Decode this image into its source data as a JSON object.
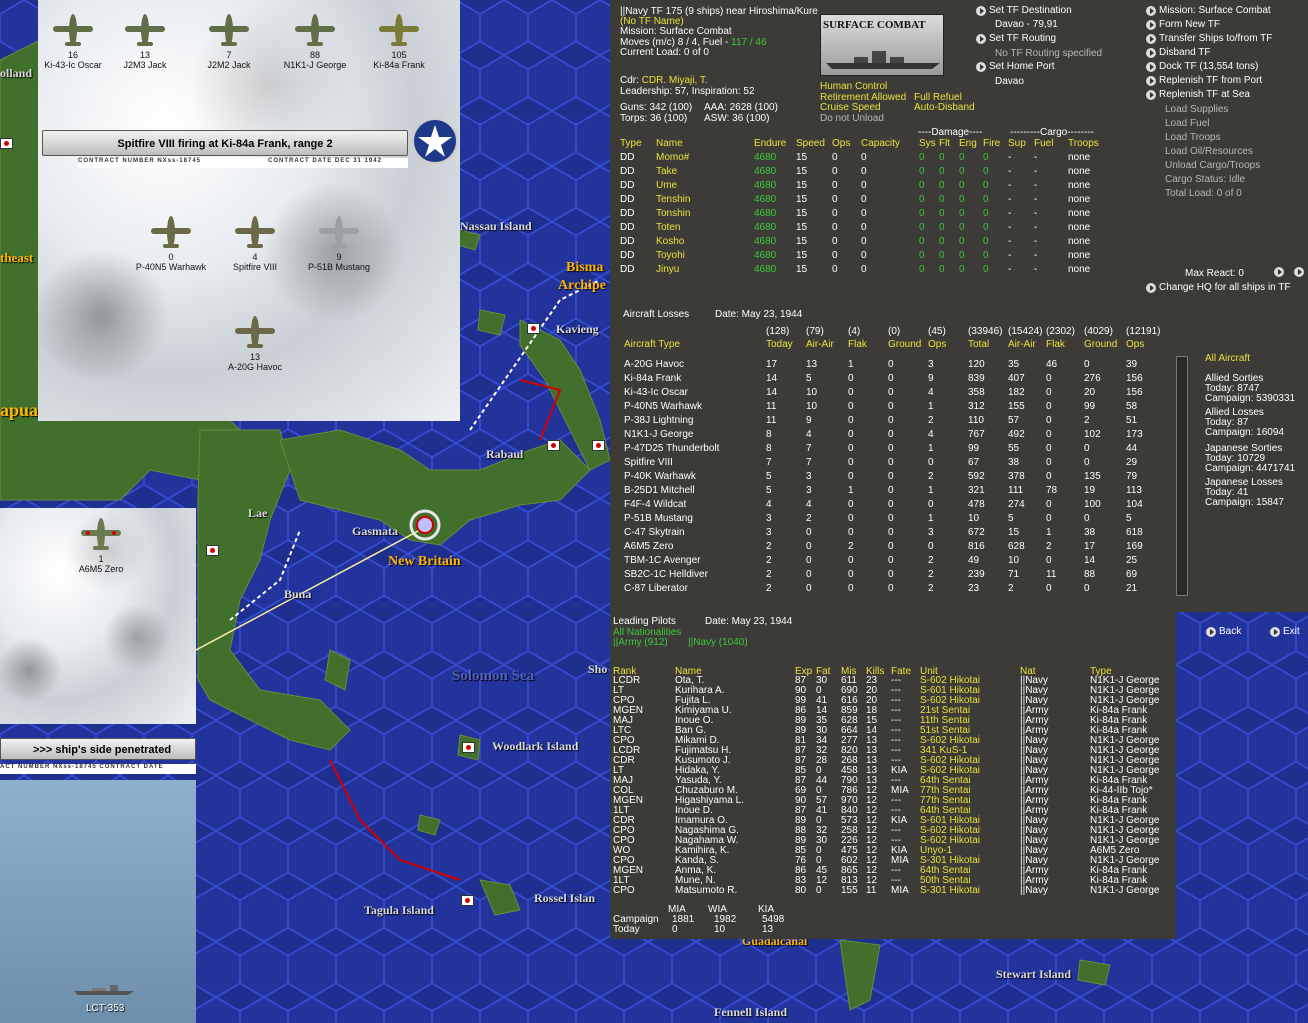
{
  "header": {
    "tf_line": "||Navy TF 175 (9 ships) near Hiroshima/Kure",
    "tf_name": "(No TF Name)",
    "mission": "Mission: Surface Combat",
    "moves": "Moves (m/c) 8 / 4, Fuel - ",
    "fuel": "117 / 46",
    "load": "Current Load: 0 of 0",
    "cdr_label": "Cdr:",
    "cdr": "CDR. Miyaji, T.",
    "leadership": "Leadership: 57, Inspiration: 52",
    "guns": "Guns: 342 (100)",
    "aaa": "AAA: 2628 (100)",
    "torps": "Torps: 36 (100)",
    "asw": "ASW: 36 (100)",
    "mission_box": "SURFACE COMBAT",
    "human": "Human Control",
    "retire": "Retirement Allowed",
    "refuel": "Full Refuel",
    "cruise": "Cruise Speed",
    "disband": "Auto-Disband",
    "unload": "Do not Unload"
  },
  "tf_controls": {
    "dest_btn": "Set TF Destination",
    "dest_val": "Davao - 79,91",
    "routing_btn": "Set TF Routing",
    "routing_val": "No TF Routing specified",
    "home_btn": "Set Home Port",
    "home_val": "Davao"
  },
  "right_menu": {
    "active": [
      "Mission: Surface Combat",
      "Form New TF",
      "Transfer Ships to/from TF",
      "Disband TF",
      "Dock TF (13,554 tons)",
      "Replenish TF from Port",
      "Replenish TF at Sea"
    ],
    "inactive": [
      "Load Supplies",
      "Load Fuel",
      "Load Troops",
      "Load Oil/Resources",
      "Unload Cargo/Troops",
      "Cargo Status: Idle",
      "Total Load: 0 of 0"
    ],
    "max_react": "Max React: 0",
    "change_hq": "Change HQ for all ships in TF"
  },
  "ships": {
    "group_damage": "----Damage----",
    "group_cargo": "---------Cargo--------",
    "headers": [
      "Type",
      "Name",
      "Endure",
      "Speed",
      "Ops",
      "Capacity",
      "Sys",
      "Flt",
      "Eng",
      "Fire",
      "Sup",
      "Fuel",
      "Troops"
    ],
    "rows": [
      [
        "DD",
        "Momo#",
        "4680",
        "15",
        "0",
        "0",
        "0",
        "0",
        "0",
        "0",
        "-",
        "-",
        "none"
      ],
      [
        "DD",
        "Take",
        "4680",
        "15",
        "0",
        "0",
        "0",
        "0",
        "0",
        "0",
        "-",
        "-",
        "none"
      ],
      [
        "DD",
        "Ume",
        "4680",
        "15",
        "0",
        "0",
        "0",
        "0",
        "0",
        "0",
        "-",
        "-",
        "none"
      ],
      [
        "DD",
        "Tenshin",
        "4680",
        "15",
        "0",
        "0",
        "0",
        "0",
        "0",
        "0",
        "-",
        "-",
        "none"
      ],
      [
        "DD",
        "Tonshin",
        "4680",
        "15",
        "0",
        "0",
        "0",
        "0",
        "0",
        "0",
        "-",
        "-",
        "none"
      ],
      [
        "DD",
        "Toten",
        "4680",
        "15",
        "0",
        "0",
        "0",
        "0",
        "0",
        "0",
        "-",
        "-",
        "none"
      ],
      [
        "DD",
        "Kosho",
        "4680",
        "15",
        "0",
        "0",
        "0",
        "0",
        "0",
        "0",
        "-",
        "-",
        "none"
      ],
      [
        "DD",
        "Toyohi",
        "4680",
        "15",
        "0",
        "0",
        "0",
        "0",
        "0",
        "0",
        "-",
        "-",
        "none"
      ],
      [
        "DD",
        "Jinyu",
        "4680",
        "15",
        "0",
        "0",
        "0",
        "0",
        "0",
        "0",
        "-",
        "-",
        "none"
      ]
    ]
  },
  "losses": {
    "title": "Aircraft Losses",
    "date": "Date: May 23, 1944",
    "totals": [
      "(128)",
      "(79)",
      "(4)",
      "(0)",
      "(45)",
      "(33946)",
      "(15424)",
      "(2302)",
      "(4029)",
      "(12191)"
    ],
    "headers": [
      "Aircraft Type",
      "Today",
      "Air-Air",
      "Flak",
      "Ground",
      "Ops",
      "Total",
      "Air-Air",
      "Flak",
      "Ground",
      "Ops"
    ],
    "rows": [
      [
        "A-20G Havoc",
        "17",
        "13",
        "1",
        "0",
        "3",
        "120",
        "35",
        "46",
        "0",
        "39"
      ],
      [
        "Ki-84a Frank",
        "14",
        "5",
        "0",
        "0",
        "9",
        "839",
        "407",
        "0",
        "276",
        "156"
      ],
      [
        "Ki-43-Ic Oscar",
        "14",
        "10",
        "0",
        "0",
        "4",
        "358",
        "182",
        "0",
        "20",
        "156"
      ],
      [
        "P-40N5 Warhawk",
        "11",
        "10",
        "0",
        "0",
        "1",
        "312",
        "155",
        "0",
        "99",
        "58"
      ],
      [
        "P-38J Lightning",
        "11",
        "9",
        "0",
        "0",
        "2",
        "110",
        "57",
        "0",
        "2",
        "51"
      ],
      [
        "N1K1-J George",
        "8",
        "4",
        "0",
        "0",
        "4",
        "767",
        "492",
        "0",
        "102",
        "173"
      ],
      [
        "P-47D25 Thunderbolt",
        "8",
        "7",
        "0",
        "0",
        "1",
        "99",
        "55",
        "0",
        "0",
        "44"
      ],
      [
        "Spitfire VIII",
        "7",
        "7",
        "0",
        "0",
        "0",
        "67",
        "38",
        "0",
        "0",
        "29"
      ],
      [
        "P-40K Warhawk",
        "5",
        "3",
        "0",
        "0",
        "2",
        "592",
        "378",
        "0",
        "135",
        "79"
      ],
      [
        "B-25D1 Mitchell",
        "5",
        "3",
        "1",
        "0",
        "1",
        "321",
        "111",
        "78",
        "19",
        "113"
      ],
      [
        "F4F-4 Wildcat",
        "4",
        "4",
        "0",
        "0",
        "0",
        "478",
        "274",
        "0",
        "100",
        "104"
      ],
      [
        "P-51B Mustang",
        "3",
        "2",
        "0",
        "0",
        "1",
        "10",
        "5",
        "0",
        "0",
        "5"
      ],
      [
        "C-47 Skytrain",
        "3",
        "0",
        "0",
        "0",
        "3",
        "672",
        "15",
        "1",
        "38",
        "618"
      ],
      [
        "A6M5 Zero",
        "2",
        "0",
        "2",
        "0",
        "0",
        "816",
        "628",
        "2",
        "17",
        "169"
      ],
      [
        "TBM-1C Avenger",
        "2",
        "0",
        "0",
        "0",
        "2",
        "49",
        "10",
        "0",
        "14",
        "25"
      ],
      [
        "SB2C-1C Helldiver",
        "2",
        "0",
        "0",
        "0",
        "2",
        "239",
        "71",
        "11",
        "88",
        "69"
      ],
      [
        "C-87 Liberator",
        "2",
        "0",
        "0",
        "0",
        "2",
        "23",
        "2",
        "0",
        "0",
        "21"
      ]
    ],
    "side": {
      "filter": "All Aircraft",
      "allied_sorties": "Allied Sorties",
      "as_today": "Today:  8747",
      "as_campaign": "Campaign: 5390331",
      "allied_losses": "Allied Losses",
      "al_today": "Today:  87",
      "al_campaign": "Campaign: 16094",
      "jp_sorties": "Japanese Sorties",
      "js_today": "Today:  10729",
      "js_campaign": "Campaign: 4471741",
      "jp_losses": "Japanese Losses",
      "jl_today": "Today:  41",
      "jl_campaign": "Campaign: 15847"
    }
  },
  "nav": {
    "back": "Back",
    "exit": "Exit"
  },
  "pilots": {
    "title": "Leading Pilots",
    "date": "Date: May 23, 1944",
    "filter": "All Nationalities",
    "army": "||Army (912)",
    "navy": "||Navy (1040)",
    "headers": [
      "Rank",
      "Name",
      "Exp",
      "Fat",
      "Mis",
      "Kills",
      "Fate",
      "Unit",
      "Nat",
      "Type"
    ],
    "rows": [
      [
        "LCDR",
        "Ota, T.",
        "87",
        "30",
        "611",
        "23",
        "---",
        "S-602 Hikotai",
        "||Navy",
        "N1K1-J George"
      ],
      [
        "LT",
        "Kurihara A.",
        "90",
        "0",
        "690",
        "20",
        "---",
        "S-601 Hikotai",
        "||Navy",
        "N1K1-J George"
      ],
      [
        "CPO",
        "Fujita L.",
        "99",
        "41",
        "616",
        "20",
        "---",
        "S-602 Hikotai",
        "||Navy",
        "N1K1-J George"
      ],
      [
        "MGEN",
        "Kimiyama U.",
        "86",
        "14",
        "859",
        "18",
        "---",
        "21st Sentai",
        "||Army",
        "Ki-84a Frank"
      ],
      [
        "MAJ",
        "Inoue O.",
        "89",
        "35",
        "628",
        "15",
        "---",
        "11th Sentai",
        "||Army",
        "Ki-84a Frank"
      ],
      [
        "LTC",
        "Ban G.",
        "89",
        "30",
        "664",
        "14",
        "---",
        "51st Sentai",
        "||Army",
        "Ki-84a Frank"
      ],
      [
        "CPO",
        "Mikami D.",
        "81",
        "34",
        "277",
        "13",
        "---",
        "S-602 Hikotai",
        "||Navy",
        "N1K1-J George"
      ],
      [
        "LCDR",
        "Fujimatsu H.",
        "87",
        "32",
        "820",
        "13",
        "---",
        "341 KuS-1",
        "||Navy",
        "N1K1-J George"
      ],
      [
        "CDR",
        "Kusumoto J.",
        "87",
        "28",
        "268",
        "13",
        "---",
        "S-602 Hikotai",
        "||Navy",
        "N1K1-J George"
      ],
      [
        "LT",
        "Hidaka, Y.",
        "85",
        "0",
        "458",
        "13",
        "KIA",
        "S-602 Hikotai",
        "||Navy",
        "N1K1-J George"
      ],
      [
        "MAJ",
        "Yasuda, Y.",
        "87",
        "44",
        "790",
        "13",
        "---",
        "64th Sentai",
        "||Army",
        "Ki-84a Frank"
      ],
      [
        "COL",
        "Chuzaburo M.",
        "69",
        "0",
        "786",
        "12",
        "MIA",
        "77th Sentai",
        "||Army",
        "Ki-44-IIb Tojo*"
      ],
      [
        "MGEN",
        "Higashiyama L.",
        "90",
        "57",
        "970",
        "12",
        "---",
        "77th Sentai",
        "||Army",
        "Ki-84a Frank"
      ],
      [
        "1LT",
        "Inoue D.",
        "87",
        "41",
        "840",
        "12",
        "---",
        "64th Sentai",
        "||Army",
        "Ki-84a Frank"
      ],
      [
        "CDR",
        "Imamura O.",
        "89",
        "0",
        "573",
        "12",
        "KIA",
        "S-601 Hikotai",
        "||Navy",
        "N1K1-J George"
      ],
      [
        "CPO",
        "Nagashima G.",
        "88",
        "32",
        "258",
        "12",
        "---",
        "S-602 Hikotai",
        "||Navy",
        "N1K1-J George"
      ],
      [
        "CPO",
        "Nagahama W.",
        "89",
        "30",
        "226",
        "12",
        "---",
        "S-602 Hikotai",
        "||Navy",
        "N1K1-J George"
      ],
      [
        "WO",
        "Kamihira, K.",
        "85",
        "0",
        "475",
        "12",
        "KIA",
        "Unyo-1",
        "||Navy",
        "A6M5 Zero"
      ],
      [
        "CPO",
        "Kanda, S.",
        "76",
        "0",
        "602",
        "12",
        "MIA",
        "S-301 Hikotai",
        "||Navy",
        "N1K1-J George"
      ],
      [
        "MGEN",
        "Anma, K.",
        "86",
        "45",
        "865",
        "12",
        "---",
        "64th Sentai",
        "||Army",
        "Ki-84a Frank"
      ],
      [
        "1LT",
        "Mune, N.",
        "83",
        "12",
        "813",
        "12",
        "---",
        "50th Sentai",
        "||Army",
        "Ki-84a Frank"
      ],
      [
        "CPO",
        "Matsumoto R.",
        "80",
        "0",
        "155",
        "11",
        "MIA",
        "S-301 Hikotai",
        "||Navy",
        "N1K1-J George"
      ]
    ],
    "summary": {
      "mia": "MIA",
      "wia": "WIA",
      "kia": "KIA",
      "campaign": "Campaign",
      "c_mia": "1881",
      "c_wia": "1982",
      "c_kia": "5498",
      "today": "Today",
      "t_mia": "0",
      "t_wia": "10",
      "t_kia": "13"
    }
  },
  "combat": {
    "japanese": [
      {
        "n": "16",
        "name": "Ki-43-Ic Oscar"
      },
      {
        "n": "13",
        "name": "J2M3 Jack"
      },
      {
        "n": "7",
        "name": "J2M2 Jack"
      },
      {
        "n": "88",
        "name": "N1K1-J George"
      },
      {
        "n": "105",
        "name": "Ki-84a Frank"
      }
    ],
    "banner": "Spitfire VIII firing at Ki-84a Frank, range 2",
    "contract_left": "CONTRACT NUMBER  NXss-18745",
    "contract_right": "CONTRACT DATE  DEC 31 1942",
    "allied": [
      {
        "n": "0",
        "name": "P-40N5 Warhawk"
      },
      {
        "n": "4",
        "name": "Spitfire VIII"
      },
      {
        "n": "9",
        "name": "P-51B Mustang"
      },
      {
        "n": "13",
        "name": "A-20G Havoc"
      }
    ],
    "left_plane": {
      "n": "1",
      "name": "A6M5 Zero"
    },
    "left_banner": ">>> ship's side penetrated",
    "left_contract": "ACT NUMBER  NXss-18745      CONTRACT DATE",
    "ship": "LCT-353"
  },
  "map_labels": {
    "new_britain": "New Britain",
    "bismarck": "Bisma",
    "archipelago": "Archipe",
    "kavieng": "Kavieng",
    "rabaul": "Rabaul",
    "gasmata": "Gasmata",
    "lae": "Lae",
    "buna": "Buna",
    "solomon": "Solomon Sea",
    "woodlark": "Woodlark Island",
    "tagula": "Tagula Island",
    "rossel": "Rossel Islan",
    "stewart": "Stewart Island",
    "fennell": "Fennell Island",
    "guadalcanal": "Guadalcanal",
    "nassau": "Nassau Island",
    "papua": "apua",
    "holland": "olland",
    "northeast": "theast",
    "sho": "Sho"
  },
  "colors": {
    "ocean": "#1f2f8f",
    "hex_line": "#3450d6",
    "land": "#3e6a2a",
    "panel": "#3c3b37",
    "accent_yellow": "#e8e23c",
    "accent_green": "#3ec83e",
    "japan_red": "#d10000"
  }
}
